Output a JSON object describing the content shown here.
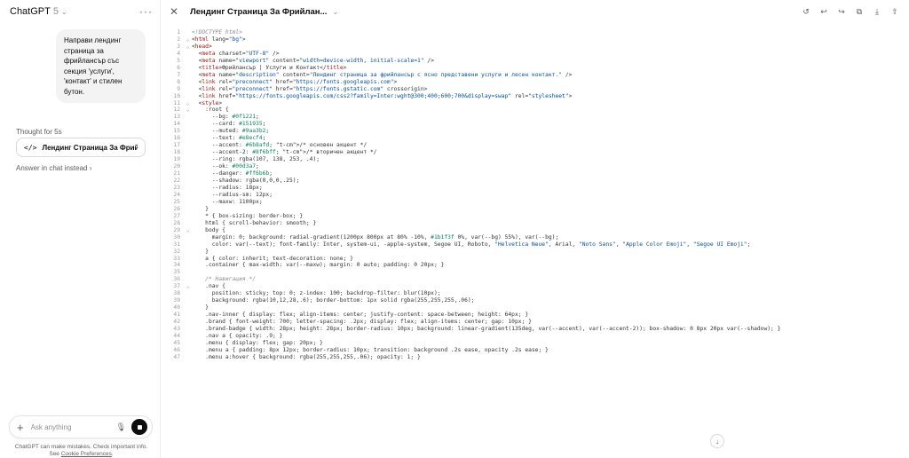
{
  "chat": {
    "model_name": "ChatGPT",
    "model_version": "5",
    "user_message": "Направи лендинг страница за фрийлансър със секция 'услуги', 'контакт' и стилен бутон.",
    "thought": "Thought for 5s",
    "artifact_title": "Лендинг Страница За Фрийлан",
    "answer_in_chat": "Answer in chat instead",
    "composer_placeholder": "Ask anything",
    "disclaimer_pre": "ChatGPT can make mistakes. Check important info. See ",
    "disclaimer_link": "Cookie Preferences",
    "disclaimer_post": "."
  },
  "canvas": {
    "title": "Лендинг Страница За Фрийлан...",
    "code_lines": [
      "<!DOCTYPE html>",
      "<html lang=\"bg\">",
      "<head>",
      "  <meta charset=\"UTF-8\" />",
      "  <meta name=\"viewport\" content=\"width=device-width, initial-scale=1\" />",
      "  <title>Фрийлансър | Услуги и Контакт</title>",
      "  <meta name=\"description\" content=\"Лендинг страница за фрийлансър с ясно представени услуги и лесен контакт.\" />",
      "  <link rel=\"preconnect\" href=\"https://fonts.googleapis.com\">",
      "  <link rel=\"preconnect\" href=\"https://fonts.gstatic.com\" crossorigin>",
      "  <link href=\"https://fonts.googleapis.com/css2?family=Inter:wght@300;400;600;700&display=swap\" rel=\"stylesheet\">",
      "  <style>",
      "    :root {",
      "      --bg: #0f1221;",
      "      --card: #151935;",
      "      --muted: #9aa3b2;",
      "      --text: #e8ecf4;",
      "      --accent: #6b8afd; /* основен акцент */",
      "      --accent-2: #8f6bff; /* вторичен акцент */",
      "      --ring: rgba(107, 138, 253, .4);",
      "      --ok: #00d3a7;",
      "      --danger: #ff6b6b;",
      "      --shadow: rgba(0,0,0,.25);",
      "      --radius: 18px;",
      "      --radius-sm: 12px;",
      "      --maxw: 1100px;",
      "    }",
      "    * { box-sizing: border-box; }",
      "    html { scroll-behavior: smooth; }",
      "    body {",
      "      margin: 0; background: radial-gradient(1200px 800px at 80% -10%, #1b1f3f 0%, var(--bg) 55%), var(--bg);",
      "      color: var(--text); font-family: Inter, system-ui, -apple-system, Segoe UI, Roboto, \"Helvetica Neue\", Arial, \"Noto Sans\", \"Apple Color Emoji\", \"Segoe UI Emoji\";",
      "    }",
      "    a { color: inherit; text-decoration: none; }",
      "    .container { max-width: var(--maxw); margin: 0 auto; padding: 0 20px; }",
      "",
      "    /* Навигация */",
      "    .nav {",
      "      position: sticky; top: 0; z-index: 100; backdrop-filter: blur(10px);",
      "      background: rgba(10,12,28,.6); border-bottom: 1px solid rgba(255,255,255,.06);",
      "    }",
      "    .nav-inner { display: flex; align-items: center; justify-content: space-between; height: 64px; }",
      "    .brand { font-weight: 700; letter-spacing: .2px; display: flex; align-items: center; gap: 10px; }",
      "    .brand-badge { width: 28px; height: 28px; border-radius: 10px; background: linear-gradient(135deg, var(--accent), var(--accent-2)); box-shadow: 0 8px 20px var(--shadow); }",
      "    .nav a { opacity: .9; }",
      "    .menu { display: flex; gap: 20px; }",
      "    .menu a { padding: 8px 12px; border-radius: 10px; transition: background .2s ease, opacity .2s ease; }",
      "    .menu a:hover { background: rgba(255,255,255,.06); opacity: 1; }"
    ],
    "folded_lines": [
      2,
      3,
      11,
      12,
      29,
      37
    ],
    "colors": {
      "accent_text": "#0451a5",
      "line_number": "#9a9a9a"
    }
  },
  "icons": {
    "more": "more-horizontal-icon",
    "close": "close-icon",
    "history": "history-icon",
    "undo": "undo-icon",
    "redo": "redo-icon",
    "copy": "copy-icon",
    "download": "download-icon",
    "share": "share-icon"
  }
}
